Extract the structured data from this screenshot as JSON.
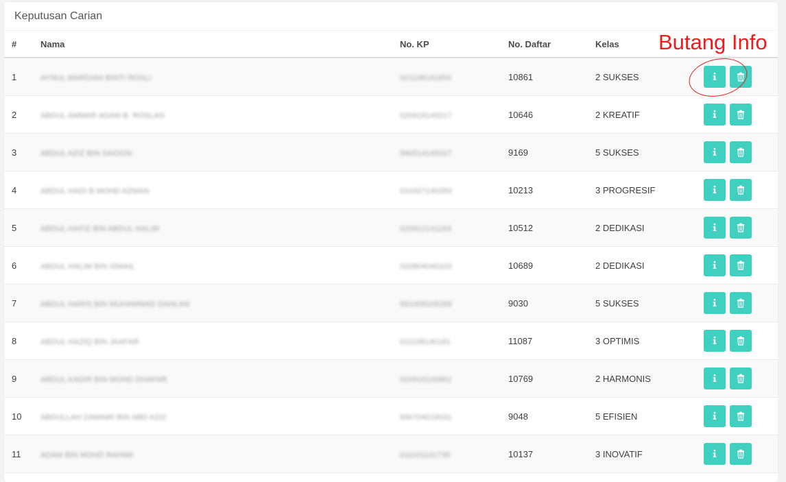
{
  "panel": {
    "title": "Keputusan Carian"
  },
  "table": {
    "headers": {
      "num": "#",
      "name": "Nama",
      "kp": "No. KP",
      "daftar": "No. Daftar",
      "kelas": "Kelas"
    },
    "rows": [
      {
        "num": "1",
        "name": "AYNUL MARDIAH BINTI ROSLI",
        "kp": "021108141650",
        "daftar": "10861",
        "kelas": "2 SUKSES"
      },
      {
        "num": "2",
        "name": "ABDUL AMMAR ADAM B. ROSLAN",
        "kp": "020918140217",
        "daftar": "10646",
        "kelas": "2 KREATIF"
      },
      {
        "num": "3",
        "name": "ABDUL AZIZ BIN SAIDON",
        "kp": "990514145027",
        "daftar": "9169",
        "kelas": "5 SUKSES"
      },
      {
        "num": "4",
        "name": "ABDUL HADI B MOHD AZMAN",
        "kp": "010327140283",
        "daftar": "10213",
        "kelas": "3 PROGRESIF"
      },
      {
        "num": "5",
        "name": "ABDUL HAFIZ BIN ABDUL HALIM",
        "kp": "020912141163",
        "daftar": "10512",
        "kelas": "2 DEDIKASI"
      },
      {
        "num": "6",
        "name": "ABDUL HALIM BIN ISMAIL",
        "kp": "020804040103",
        "daftar": "10689",
        "kelas": "2 DEDIKASI"
      },
      {
        "num": "7",
        "name": "ABDUL HARIS BIN MUHAMMAD DAHLAN",
        "kp": "991008105289",
        "daftar": "9030",
        "kelas": "5 SUKSES"
      },
      {
        "num": "8",
        "name": "ABDUL HAZIQ BIN JAAFAR",
        "kp": "011108140181",
        "daftar": "11087",
        "kelas": "3 OPTIMIS"
      },
      {
        "num": "9",
        "name": "ABDUL KADIR BIN MOHD GHAFAR",
        "kp": "020916100801",
        "daftar": "10769",
        "kelas": "2 HARMONIS"
      },
      {
        "num": "10",
        "name": "ABDULLAH ZAWAWI BIN ABD AZIZ",
        "kp": "990704016031",
        "daftar": "9048",
        "kelas": "5 EFISIEN"
      },
      {
        "num": "11",
        "name": "ADAM BIN MOHD RAHIMI",
        "kp": "011101141739",
        "daftar": "10137",
        "kelas": "3 INOVATIF"
      }
    ]
  },
  "buttons": {
    "info_icon": "info-icon",
    "delete_icon": "trash-icon",
    "color": "#3fd0bf"
  },
  "annotation": {
    "label": "Butang Info",
    "color": "#ec1c1c"
  }
}
